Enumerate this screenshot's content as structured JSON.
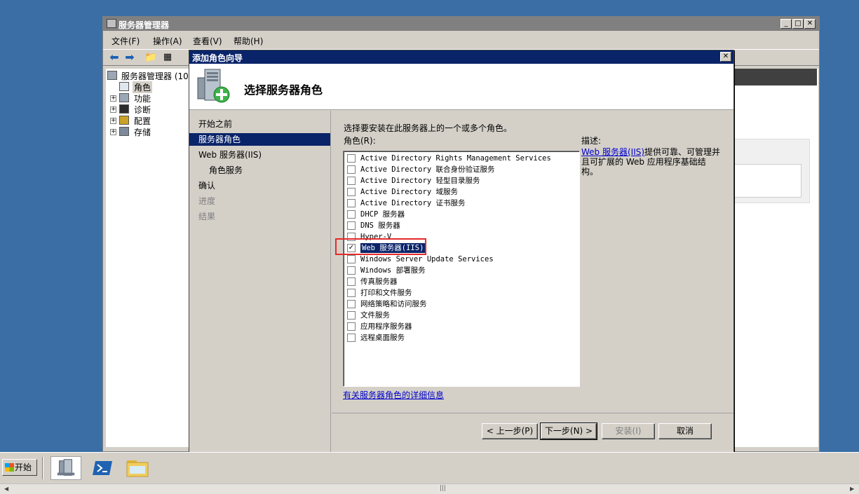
{
  "server_manager": {
    "title": "服务器管理器",
    "controls": {
      "minimize": "_",
      "maximize": "□",
      "close": "✕"
    },
    "menu": [
      "文件(F)",
      "操作(A)",
      "查看(V)",
      "帮助(H)"
    ],
    "tree": {
      "root": "服务器管理器 (10",
      "items": [
        {
          "label": "角色",
          "expander": ""
        },
        {
          "label": "功能",
          "expander": "+"
        },
        {
          "label": "诊断",
          "expander": "+"
        },
        {
          "label": "配置",
          "expander": "+"
        },
        {
          "label": "存储",
          "expander": "+"
        }
      ]
    }
  },
  "wizard": {
    "title": "添加角色向导",
    "close_glyph": "✕",
    "header_title": "选择服务器角色",
    "nav": [
      {
        "label": "开始之前",
        "state": "normal"
      },
      {
        "label": "服务器角色",
        "state": "active"
      },
      {
        "label": "Web 服务器(IIS)",
        "state": "normal"
      },
      {
        "label": "角色服务",
        "state": "sub"
      },
      {
        "label": "确认",
        "state": "normal"
      },
      {
        "label": "进度",
        "state": "disabled"
      },
      {
        "label": "结果",
        "state": "disabled"
      }
    ],
    "intro": "选择要安装在此服务器上的一个或多个角色。",
    "roles_label": "角色(R):",
    "roles": [
      {
        "label": "Active Directory Rights Management Services",
        "checked": false
      },
      {
        "label": "Active Directory 联合身份验证服务",
        "checked": false
      },
      {
        "label": "Active Directory 轻型目录服务",
        "checked": false
      },
      {
        "label": "Active Directory 域服务",
        "checked": false
      },
      {
        "label": "Active Directory 证书服务",
        "checked": false
      },
      {
        "label": "DHCP 服务器",
        "checked": false
      },
      {
        "label": "DNS 服务器",
        "checked": false
      },
      {
        "label": "Hyper-V",
        "checked": false
      },
      {
        "label": "Web 服务器(IIS)",
        "checked": true,
        "selected": true
      },
      {
        "label": "Windows Server Update Services",
        "checked": false
      },
      {
        "label": "Windows 部署服务",
        "checked": false
      },
      {
        "label": "传真服务器",
        "checked": false
      },
      {
        "label": "打印和文件服务",
        "checked": false
      },
      {
        "label": "网络策略和访问服务",
        "checked": false
      },
      {
        "label": "文件服务",
        "checked": false
      },
      {
        "label": "应用程序服务器",
        "checked": false
      },
      {
        "label": "远程桌面服务",
        "checked": false
      }
    ],
    "check_glyph": "✓",
    "description": {
      "title": "描述:",
      "link": "Web 服务器(IIS)",
      "text": "提供可靠、可管理并且可扩展的 Web 应用程序基础结构。"
    },
    "more_info_link": "有关服务器角色的详细信息",
    "buttons": {
      "back": "< 上一步(P)",
      "next": "下一步(N) >",
      "install": "安装(I)",
      "cancel": "取消"
    }
  },
  "taskbar": {
    "start": "开始",
    "tasks": [
      "server-manager",
      "powershell",
      "explorer"
    ]
  },
  "colors": {
    "desktop": "#3a6ea5",
    "selection": "#0a246a",
    "highlight_box": "#e52a2a",
    "link": "#0000cc"
  }
}
